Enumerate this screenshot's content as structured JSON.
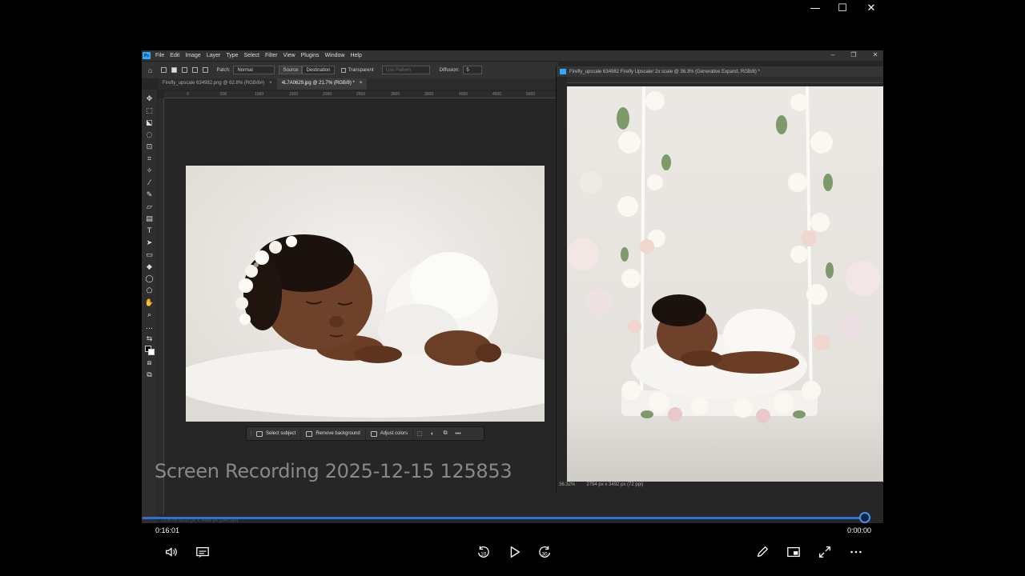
{
  "window": {
    "minimize_glyph": "—",
    "maximize_glyph": "☐",
    "close_glyph": "✕"
  },
  "photoshop": {
    "logo_text": "Ps",
    "menu": [
      "File",
      "Edit",
      "Image",
      "Layer",
      "Type",
      "Select",
      "Filter",
      "View",
      "Plugins",
      "Window",
      "Help"
    ],
    "options_bar": {
      "patch_label": "Patch:",
      "patch_value": "Normal",
      "source_label": "Source",
      "destination_label": "Destination",
      "transparent_label": "Transparent",
      "use_pattern_label": "Use Pattern",
      "diffusion_label": "Diffusion:",
      "diffusion_value": "5"
    },
    "tabs": [
      {
        "label": "Firefly_upscale 634982.png @ 62.8% (RGB/8#)",
        "close": "×"
      },
      {
        "label": "4L7A0629.jpg @ 21.7% (RGB/8) *",
        "close": "×"
      }
    ],
    "ruler_ticks": [
      "0",
      "500",
      "1000",
      "1500",
      "2000",
      "2500",
      "3000",
      "3500",
      "4000",
      "4500",
      "5000"
    ],
    "contextual_bar": {
      "select_subject": "Select subject",
      "remove_background": "Remove background",
      "adjust_colors": "Adjust colors",
      "more": "•••"
    },
    "status_left": "21.67%   5202 px x 3468 px (240 ppi)",
    "second_window": {
      "title": "Firefly_upscale 634982 Firefly Upscaler 2x scale @ 36.3% (Generative Expand, RGB/8) *",
      "zoom": "36.32%",
      "dimensions": "2794 px x 3492 px (72 ppi)"
    }
  },
  "watermark": "Screen Recording 2025-12-15 125853",
  "player": {
    "time_elapsed": "0:16:01",
    "time_remaining": "0:00:00",
    "progress": 0.99,
    "skip_back_label": "10",
    "skip_forward_label": "30"
  }
}
